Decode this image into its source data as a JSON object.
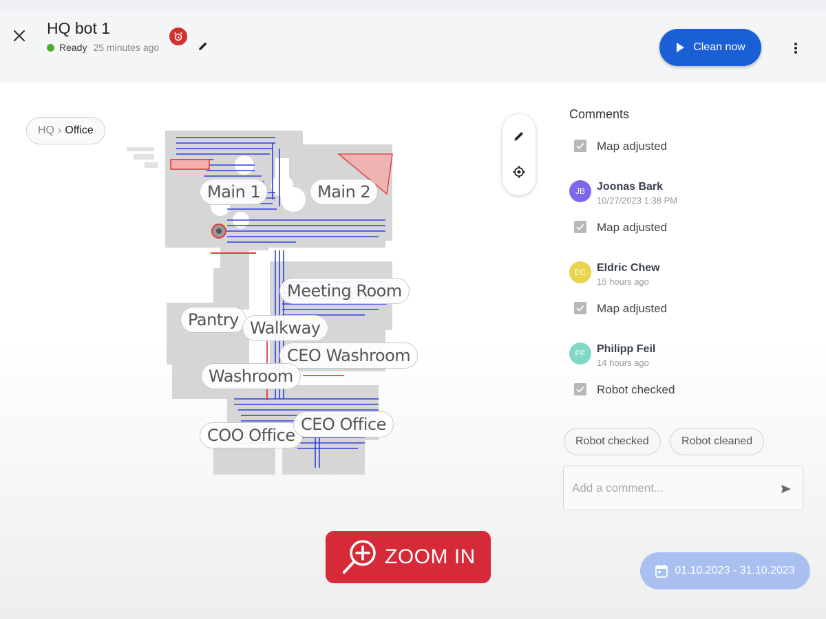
{
  "header": {
    "title": "HQ bot 1",
    "status": "Ready",
    "last_seen": "25 minutes ago",
    "clean_label": "Clean now",
    "accent": "#1a5fd6",
    "status_color": "#4caf2f",
    "alarm_color": "#d32f2f"
  },
  "breadcrumb": {
    "parent": "HQ",
    "separator": "›",
    "current": "Office"
  },
  "map": {
    "rooms": [
      "Main 1",
      "Main 2",
      "Meeting Room",
      "Pantry",
      "Walkway",
      "CEO Washroom",
      "Washroom",
      "COO Office",
      "CEO Office"
    ]
  },
  "comments": {
    "title": "Comments",
    "items": [
      {
        "text": "Map adjusted"
      },
      {
        "author": "Joonas Bark",
        "initials": "JB",
        "time": "10/27/2023 1:38 PM",
        "text": "Map adjusted",
        "color": "#7b68ee"
      },
      {
        "author": "Eldric Chew",
        "initials": "EC",
        "time": "15 hours ago",
        "text": "Map adjusted",
        "color": "#e8d44d"
      },
      {
        "author": "Philipp Feil",
        "initials": "PF",
        "time": "14 hours ago",
        "text": "Robot checked",
        "color": "#7fd8c4"
      }
    ],
    "quick_chips": [
      "Robot checked",
      "Robot cleaned"
    ],
    "input_placeholder": "Add a comment..."
  },
  "zoom": {
    "label": "ZOOM IN",
    "color": "#d62a38"
  },
  "date_range": {
    "label": "01.10.2023 - 31.10.2023",
    "color": "#a9bff0"
  }
}
